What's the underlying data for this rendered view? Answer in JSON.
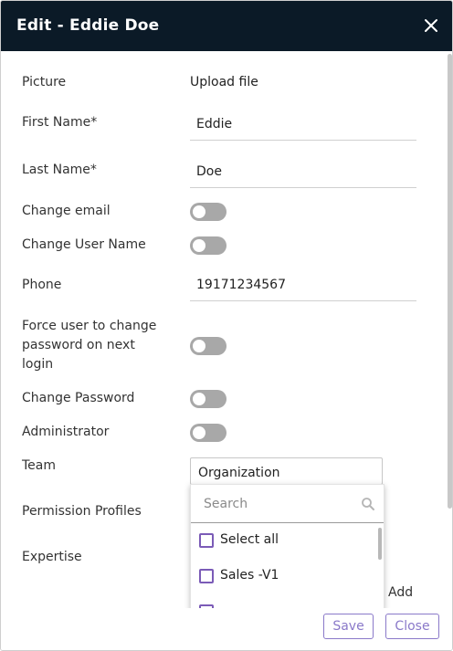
{
  "dialog": {
    "title": "Edit - Eddie Doe"
  },
  "form": {
    "picture_label": "Picture",
    "upload_label": "Upload file",
    "first_name_label": "First Name*",
    "first_name_value": "Eddie",
    "last_name_label": "Last Name*",
    "last_name_value": "Doe",
    "change_email_label": "Change email",
    "change_username_label": "Change User Name",
    "phone_label": "Phone",
    "phone_value": "19171234567",
    "force_change_label_line1": "Force user to change",
    "force_change_label_line2": "password on next",
    "force_change_label_line3": "login",
    "change_password_label": "Change Password",
    "administrator_label": "Administrator",
    "team_label": "Team",
    "team_value": "Organization",
    "permission_profiles_label": "Permission Profiles",
    "expertise_label": "Expertise",
    "add_label": "Add"
  },
  "toggles": {
    "change_email": false,
    "change_username": false,
    "force_change_password": false,
    "change_password": false,
    "administrator": false
  },
  "team_dropdown": {
    "search_placeholder": "Search",
    "items": [
      {
        "label": "Select all",
        "checked": false
      },
      {
        "label": "Sales -V1",
        "checked": false
      },
      {
        "label": "",
        "checked": false
      }
    ]
  },
  "footer": {
    "save_label": "Save",
    "close_label": "Close"
  },
  "colors": {
    "header_bg": "#0b1a27",
    "accent": "#8a79c9",
    "checkbox_border": "#7b5bb7",
    "toggle_off": "#a8a8a8"
  }
}
